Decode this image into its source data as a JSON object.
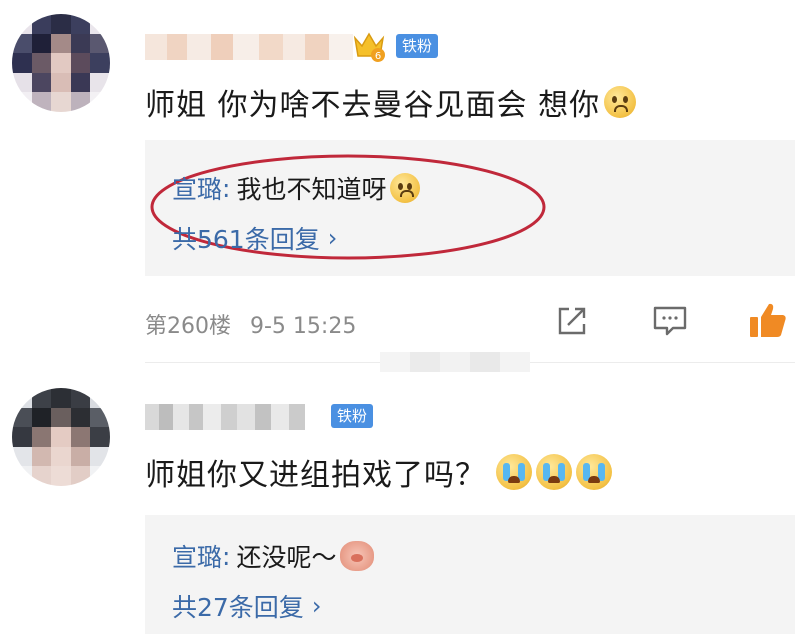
{
  "comments": [
    {
      "badge": "铁粉",
      "text": "师姐 你为啥不去曼谷见面会 想你",
      "emoji": "sad-face",
      "reply": {
        "author": "宣璐",
        "sep": ":",
        "text": "我也不知道呀",
        "emoji": "sad-face"
      },
      "reply_count": "共561条回复",
      "floor": "第260楼",
      "datetime": "9-5 15:25",
      "highlight_color": "#c0283a"
    },
    {
      "badge": "铁粉",
      "text": "师姐你又进组拍戏了吗？",
      "emoji": "crying-face",
      "reply": {
        "author": "宣璐",
        "sep": ":",
        "text": "还没呢～",
        "emoji": "pig-face"
      },
      "reply_count": "共27条回复"
    }
  ],
  "icons": {
    "share": "share-icon",
    "comment": "comment-icon",
    "like": "thumbs-up-icon",
    "chevron": "chevron-right-icon",
    "vip": "crown-level-icon"
  },
  "colors": {
    "badge": "#4a90e2",
    "link": "#3b6aa8",
    "like": "#f08a24",
    "reply_bg": "#f4f4f4"
  }
}
